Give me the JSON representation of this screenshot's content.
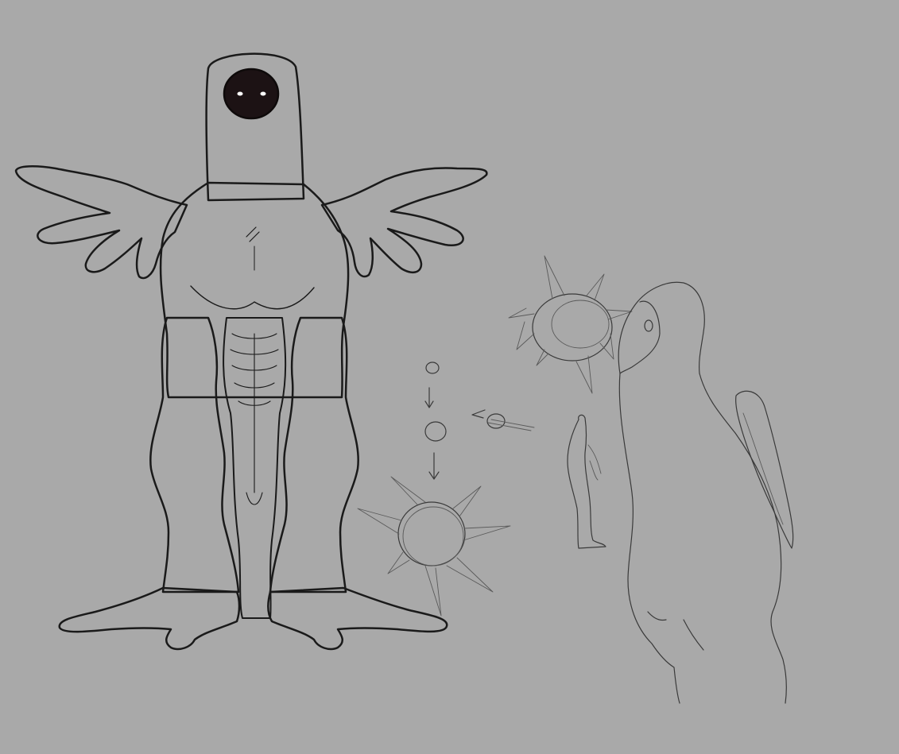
{
  "canvas": {
    "background": "#a9a9a9"
  },
  "colors": {
    "flesh": "#6a2a2c",
    "flesh_dark": "#2e1416",
    "flesh_light": "#8a3c3c",
    "outline": "#141010",
    "eye": "#ffffff",
    "face_hole": "#1c1214",
    "sketch_line": "#3a3a3a"
  },
  "artwork": {
    "subject": "creature-concept-sheet",
    "elements": [
      "creature-front-view",
      "sphere-transformation-sketches",
      "creature-side-view-sketch",
      "small-figure-sketch"
    ]
  }
}
